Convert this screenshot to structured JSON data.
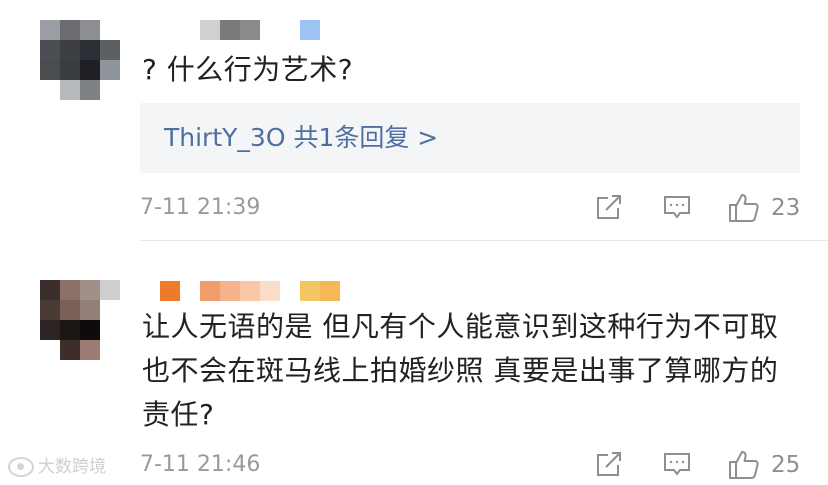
{
  "comments": [
    {
      "text": "? 什么行为艺术?",
      "reply_summary": "ThirtY_3O  共1条回复 >",
      "timestamp": "7-11 21:39",
      "like_count": "23",
      "avatar_colors": [
        "#9a9da4",
        "#6b6d72",
        "#8c8e92",
        "#ffffff",
        "#4b4e52",
        "#3d3f41",
        "#2c3036",
        "#5c6062",
        "#4a4d4f",
        "#3a3d42",
        "#1e2023",
        "#8e9499",
        "#ffffff",
        "#b6b9bd",
        "#7e8185",
        "#ffffff"
      ],
      "name_colors": [
        "#ffffff",
        "#d0d0d0",
        "#7a7a7a",
        "#8b8b8b",
        "#ffffff",
        "#ffffff",
        "#9ec4f3"
      ]
    },
    {
      "text": "让人无语的是 但凡有个人能意识到这种行为不可取也不会在斑马线上拍婚纱照 真要是出事了算哪方的责任?",
      "timestamp": "7-11 21:46",
      "like_count": "25",
      "avatar_colors": [
        "#3a2f2c",
        "#8a7068",
        "#a09088",
        "#cfcfcf",
        "#4a3a36",
        "#7b605a",
        "#958079",
        "#ffffff",
        "#2c2422",
        "#1c1614",
        "#0f0b0a",
        "#ffffff",
        "#ffffff",
        "#3d2e2a",
        "#9b7c72",
        "#ffffff"
      ],
      "name_colors": [
        "#ef7b2a",
        "#ffffff",
        "#f39c6b",
        "#f6b28a",
        "#f9c6a6",
        "#fbdcc8",
        "#ffffff",
        "#f3c663",
        "#f5b857"
      ]
    }
  ],
  "icons": {
    "share": "share-icon",
    "comment": "comment-icon",
    "like": "thumbs-up-icon"
  },
  "watermark_text": "大数跨境",
  "colors": {
    "reply_link": "#4f6fa0",
    "reply_bg": "#f4f5f7",
    "meta_text": "#9a9a9a",
    "body_text": "#222222"
  }
}
